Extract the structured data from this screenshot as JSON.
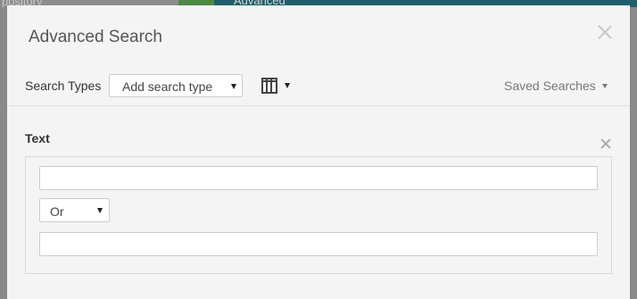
{
  "background": {
    "breadcrumb_fragment": "pository",
    "tab_fragment": "Advanced"
  },
  "modal": {
    "title": "Advanced Search",
    "toolbar": {
      "search_types_label": "Search Types",
      "search_type_select": {
        "selected": "Add search type"
      },
      "columns_icon": "columns-icon",
      "saved_searches_label": "Saved Searches"
    },
    "section": {
      "title": "Text",
      "inputs": [
        {
          "value": "",
          "placeholder": ""
        },
        {
          "value": "",
          "placeholder": ""
        }
      ],
      "operator": {
        "selected": "Or"
      }
    }
  },
  "colors": {
    "overlay": "#8a8a8a",
    "modal_bg": "#f4f4f4",
    "header_bar": "#1d5f6b"
  }
}
